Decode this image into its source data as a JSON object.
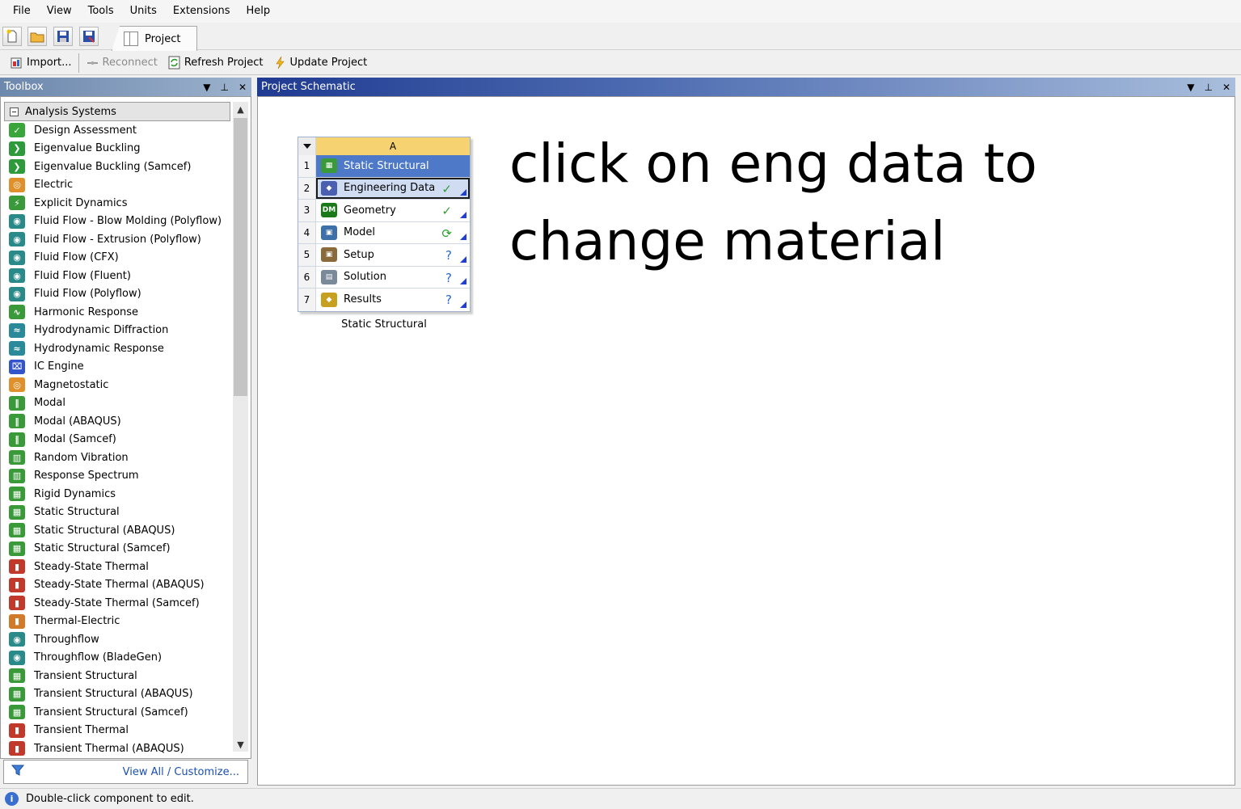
{
  "menu": [
    "File",
    "View",
    "Tools",
    "Units",
    "Extensions",
    "Help"
  ],
  "tabs": {
    "project": "Project"
  },
  "toolbar2": {
    "import": "Import...",
    "reconnect": "Reconnect",
    "refresh": "Refresh Project",
    "update": "Update Project"
  },
  "toolbox": {
    "title": "Toolbox",
    "group": "Analysis Systems",
    "items": [
      {
        "label": "Design Assessment",
        "icon": "check-icon",
        "color": "#3aa53a"
      },
      {
        "label": "Eigenvalue Buckling",
        "icon": "buckling-icon",
        "color": "#2f9a3c"
      },
      {
        "label": "Eigenvalue Buckling (Samcef)",
        "icon": "buckling-icon",
        "color": "#2f9a3c"
      },
      {
        "label": "Electric",
        "icon": "electric-icon",
        "color": "#e0902a"
      },
      {
        "label": "Explicit Dynamics",
        "icon": "explicit-icon",
        "color": "#3a9a3a"
      },
      {
        "label": "Fluid Flow - Blow Molding (Polyflow)",
        "icon": "fluid-icon",
        "color": "#2a8a8a"
      },
      {
        "label": "Fluid Flow - Extrusion (Polyflow)",
        "icon": "fluid-icon",
        "color": "#2a8a8a"
      },
      {
        "label": "Fluid Flow (CFX)",
        "icon": "fluid-icon",
        "color": "#2a8a8a"
      },
      {
        "label": "Fluid Flow (Fluent)",
        "icon": "fluid-icon",
        "color": "#2a8a8a"
      },
      {
        "label": "Fluid Flow (Polyflow)",
        "icon": "fluid-icon",
        "color": "#2a8a8a"
      },
      {
        "label": "Harmonic Response",
        "icon": "harmonic-icon",
        "color": "#3a9a3a"
      },
      {
        "label": "Hydrodynamic Diffraction",
        "icon": "hydro-icon",
        "color": "#2a8a9a"
      },
      {
        "label": "Hydrodynamic Response",
        "icon": "hydro-icon",
        "color": "#2a8a9a"
      },
      {
        "label": "IC Engine",
        "icon": "ic-engine-icon",
        "color": "#3355cc"
      },
      {
        "label": "Magnetostatic",
        "icon": "magnet-icon",
        "color": "#e0902a"
      },
      {
        "label": "Modal",
        "icon": "modal-icon",
        "color": "#3a9a3a"
      },
      {
        "label": "Modal (ABAQUS)",
        "icon": "modal-icon",
        "color": "#3a9a3a"
      },
      {
        "label": "Modal (Samcef)",
        "icon": "modal-icon",
        "color": "#3a9a3a"
      },
      {
        "label": "Random Vibration",
        "icon": "vibration-icon",
        "color": "#3a9a3a"
      },
      {
        "label": "Response Spectrum",
        "icon": "spectrum-icon",
        "color": "#3a9a3a"
      },
      {
        "label": "Rigid Dynamics",
        "icon": "rigid-icon",
        "color": "#3a9a3a"
      },
      {
        "label": "Static Structural",
        "icon": "structural-icon",
        "color": "#3a9a3a"
      },
      {
        "label": "Static Structural (ABAQUS)",
        "icon": "structural-icon",
        "color": "#3a9a3a"
      },
      {
        "label": "Static Structural (Samcef)",
        "icon": "structural-icon",
        "color": "#3a9a3a"
      },
      {
        "label": "Steady-State Thermal",
        "icon": "thermal-icon",
        "color": "#c0392b"
      },
      {
        "label": "Steady-State Thermal (ABAQUS)",
        "icon": "thermal-icon",
        "color": "#c0392b"
      },
      {
        "label": "Steady-State Thermal (Samcef)",
        "icon": "thermal-icon",
        "color": "#c0392b"
      },
      {
        "label": "Thermal-Electric",
        "icon": "thermal-electric-icon",
        "color": "#d07a2a"
      },
      {
        "label": "Throughflow",
        "icon": "fluid-icon",
        "color": "#2a8a8a"
      },
      {
        "label": "Throughflow (BladeGen)",
        "icon": "fluid-icon",
        "color": "#2a8a8a"
      },
      {
        "label": "Transient Structural",
        "icon": "transient-icon",
        "color": "#3a9a3a"
      },
      {
        "label": "Transient Structural (ABAQUS)",
        "icon": "transient-icon",
        "color": "#3a9a3a"
      },
      {
        "label": "Transient Structural (Samcef)",
        "icon": "transient-icon",
        "color": "#3a9a3a"
      },
      {
        "label": "Transient Thermal",
        "icon": "thermal-icon",
        "color": "#c0392b"
      },
      {
        "label": "Transient Thermal (ABAQUS)",
        "icon": "thermal-icon",
        "color": "#c0392b"
      }
    ],
    "view_all": "View All / Customize..."
  },
  "schematic": {
    "title": "Project Schematic",
    "system": {
      "column": "A",
      "caption": "Static Structural",
      "rows": [
        {
          "num": "1",
          "label": "Static Structural",
          "icon": "structural-icon",
          "status": ""
        },
        {
          "num": "2",
          "label": "Engineering Data",
          "icon": "engineering-data-icon",
          "status": "✓"
        },
        {
          "num": "3",
          "label": "Geometry",
          "icon": "geometry-icon",
          "status": "✓"
        },
        {
          "num": "4",
          "label": "Model",
          "icon": "model-icon",
          "status": "⟳"
        },
        {
          "num": "5",
          "label": "Setup",
          "icon": "setup-icon",
          "status": "?"
        },
        {
          "num": "6",
          "label": "Solution",
          "icon": "solution-icon",
          "status": "?"
        },
        {
          "num": "7",
          "label": "Results",
          "icon": "results-icon",
          "status": "?"
        }
      ]
    },
    "note_line1": "click on eng data to",
    "note_line2": "change material"
  },
  "status_bar": "Double-click component to edit."
}
